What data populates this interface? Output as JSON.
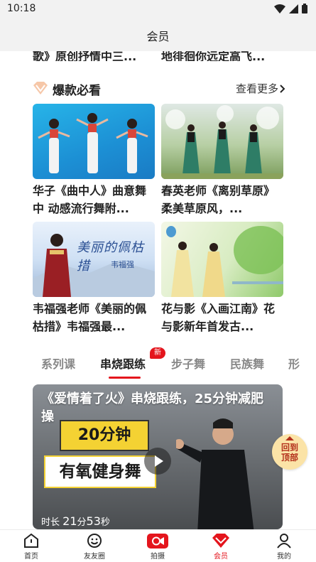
{
  "status_bar": {
    "time": "10:18"
  },
  "header": {
    "title": "会员"
  },
  "previous_row": {
    "left_fragment": "歌》原创抒情中三...",
    "right_fragment": "地徘徊你远定高飞..."
  },
  "hot_section": {
    "title": "爆款必看",
    "more_label": "查看更多",
    "icon": "diamond-icon",
    "items": [
      {
        "title": "华子《曲中人》曲意舞中 动感流行舞附..."
      },
      {
        "title": "春英老师《离别草原》柔美草原风，..."
      },
      {
        "title": "韦福强老师《美丽的佩枯措》韦福强最...",
        "thumb_text": "美丽的佩枯措",
        "thumb_subtext": "韦福强"
      },
      {
        "title": "花与影《入画江南》花与影新年首发古..."
      }
    ]
  },
  "tabs": {
    "items": [
      "系列课",
      "串烧跟练",
      "步子舞",
      "民族舞",
      "形"
    ],
    "active_index": 1,
    "badge": "新"
  },
  "video": {
    "title": "《爱情着了火》串烧跟练，25分钟减肥操",
    "overlay_line1": "20分钟",
    "overlay_line2": "有氧健身舞",
    "duration_prefix": "时长",
    "duration_min": "21",
    "duration_min_unit": "分",
    "duration_sec": "53",
    "duration_sec_unit": "秒"
  },
  "back_to_top": {
    "line1": "回到",
    "line2": "顶部"
  },
  "bottom_nav": {
    "items": [
      {
        "label": "首页",
        "icon": "home-icon"
      },
      {
        "label": "友友圈",
        "icon": "smile-icon"
      },
      {
        "label": "拍摄",
        "icon": "camera-icon"
      },
      {
        "label": "会员",
        "icon": "vip-icon"
      },
      {
        "label": "我的",
        "icon": "person-icon"
      }
    ],
    "active_index": 3
  },
  "colors": {
    "accent": "#e4151d",
    "back_top_bg": "#fbe3a7",
    "yellow": "#f4d233"
  }
}
